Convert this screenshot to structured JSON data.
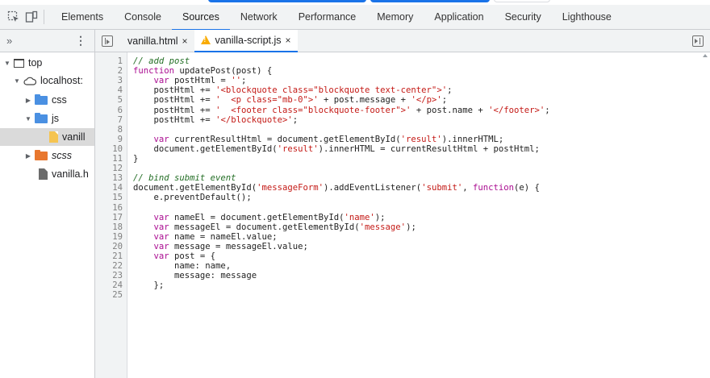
{
  "toolbar": {
    "tabs": [
      {
        "label": "Elements"
      },
      {
        "label": "Console"
      },
      {
        "label": "Sources"
      },
      {
        "label": "Network"
      },
      {
        "label": "Performance"
      },
      {
        "label": "Memory"
      },
      {
        "label": "Application"
      },
      {
        "label": "Security"
      },
      {
        "label": "Lighthouse"
      }
    ],
    "active_tab": "Sources"
  },
  "navigator": {
    "more_icon": "double-chevron-right-icon",
    "menu_icon": "kebab-menu-icon",
    "tree": [
      {
        "label": "top",
        "icon": "frame-icon"
      },
      {
        "label": "localhost:",
        "icon": "cloud-icon"
      },
      {
        "label": "css",
        "icon": "folder-icon"
      },
      {
        "label": "js",
        "icon": "folder-icon"
      },
      {
        "label": "vanill",
        "icon": "file-icon"
      },
      {
        "label": "scss",
        "icon": "folder-icon"
      },
      {
        "label": "vanilla.h",
        "icon": "file-icon"
      }
    ]
  },
  "editor_tabs": [
    {
      "label": "vanilla.html",
      "close": "×"
    },
    {
      "label": "vanilla-script.js",
      "close": "×"
    }
  ],
  "code": {
    "lines": [
      "// add post",
      "function updatePost(post) {",
      "    var postHtml = '';",
      "    postHtml += '<blockquote class=\"blockquote text-center\">';",
      "    postHtml += '  <p class=\"mb-0\">' + post.message + '</p>';",
      "    postHtml += '  <footer class=\"blockquote-footer\">' + post.name + '</footer>';",
      "    postHtml += '</blockquote>';",
      "",
      "    var currentResultHtml = document.getElementById('result').innerHTML;",
      "    document.getElementById('result').innerHTML = currentResultHtml + postHtml;",
      "}",
      "",
      "// bind submit event",
      "document.getElementById('messageForm').addEventListener('submit', function(e) {",
      "    e.preventDefault();",
      "",
      "    var nameEl = document.getElementById('name');",
      "    var messageEl = document.getElementById('message');",
      "    var name = nameEl.value;",
      "    var message = messageEl.value;",
      "    var post = {",
      "        name: name,",
      "        message: message",
      "    };",
      ""
    ]
  },
  "colors": {
    "accent": "#1a73e8",
    "comment": "#236e25",
    "keyword": "#aa0d91",
    "string": "#c41a16"
  }
}
